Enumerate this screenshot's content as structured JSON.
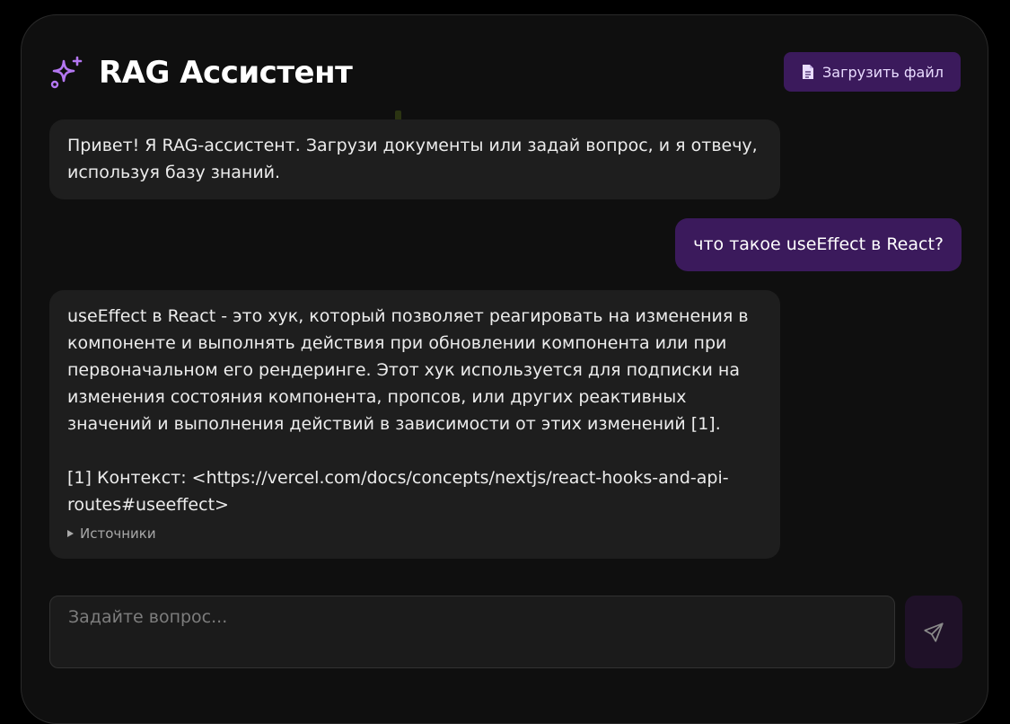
{
  "header": {
    "title": "RAG Ассистент",
    "upload_label": "Загрузить файл",
    "title_icon": "sparkle-icon",
    "upload_icon": "document-icon"
  },
  "messages": [
    {
      "role": "assistant",
      "text": "Привет! Я RAG-ассистент. Загрузи документы или задай вопрос, и я отвечу, используя базу знаний."
    },
    {
      "role": "user",
      "text": "что такое useEffect в React?"
    },
    {
      "role": "assistant",
      "text": "useEffect в React - это хук, который позволяет реагировать на изменения в компоненте и выполнять действия при обновлении компонента или при первоначальном его рендеринге. Этот хук используется для подписки на изменения состояния компонента, пропсов, или других реактивных значений и выполнения действий в зависимости от этих изменений [1].",
      "citation": "[1] Контекст: <https://vercel.com/docs/concepts/nextjs/react-hooks-and-api-routes#useeffect>",
      "sources_label": "Источники"
    }
  ],
  "input": {
    "placeholder": "Задайте вопрос...",
    "value": ""
  },
  "send_icon": "send-icon",
  "colors": {
    "accent": "#3b1a5c",
    "accent_text": "#e9dcff",
    "icon_purple": "#b477f2",
    "bubble_bg": "#1e1e1e",
    "panel_bg": "#0f0f0f",
    "send_bg": "#1f1128"
  }
}
